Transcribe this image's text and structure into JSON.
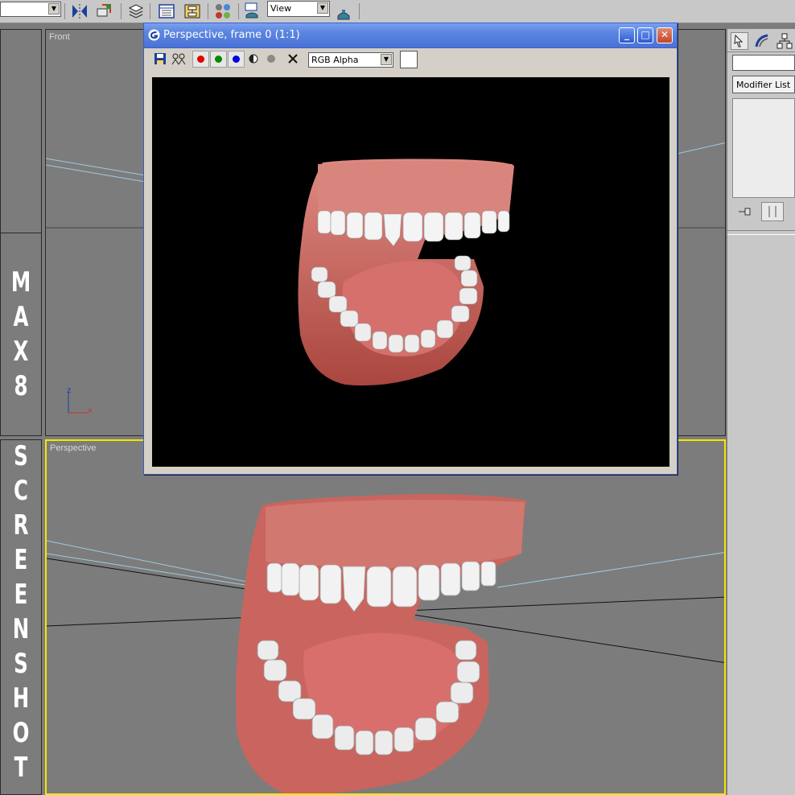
{
  "toolbar": {
    "named_selection_value": "",
    "reference_coord_value": "View"
  },
  "viewports": {
    "front_label": "Front",
    "perspective_label": "Perspective",
    "axis_z": "z",
    "axis_x": "x"
  },
  "side_strip": {
    "letters": [
      "M",
      "A",
      "X",
      "8",
      "S",
      "C",
      "R",
      "E",
      "E",
      "N",
      "S",
      "H",
      "O",
      "T"
    ]
  },
  "render_window": {
    "title": "Perspective, frame 0 (1:1)",
    "channel_select_value": "RGB Alpha"
  },
  "command_panel": {
    "modifier_list_label": "Modifier List"
  },
  "colors": {
    "title_bar": "#4a72d6",
    "viewport_bg": "#7c7c7c",
    "active_viewport_border": "#f5e600",
    "gum": "#c96a62",
    "tooth": "#f2f2f2"
  }
}
